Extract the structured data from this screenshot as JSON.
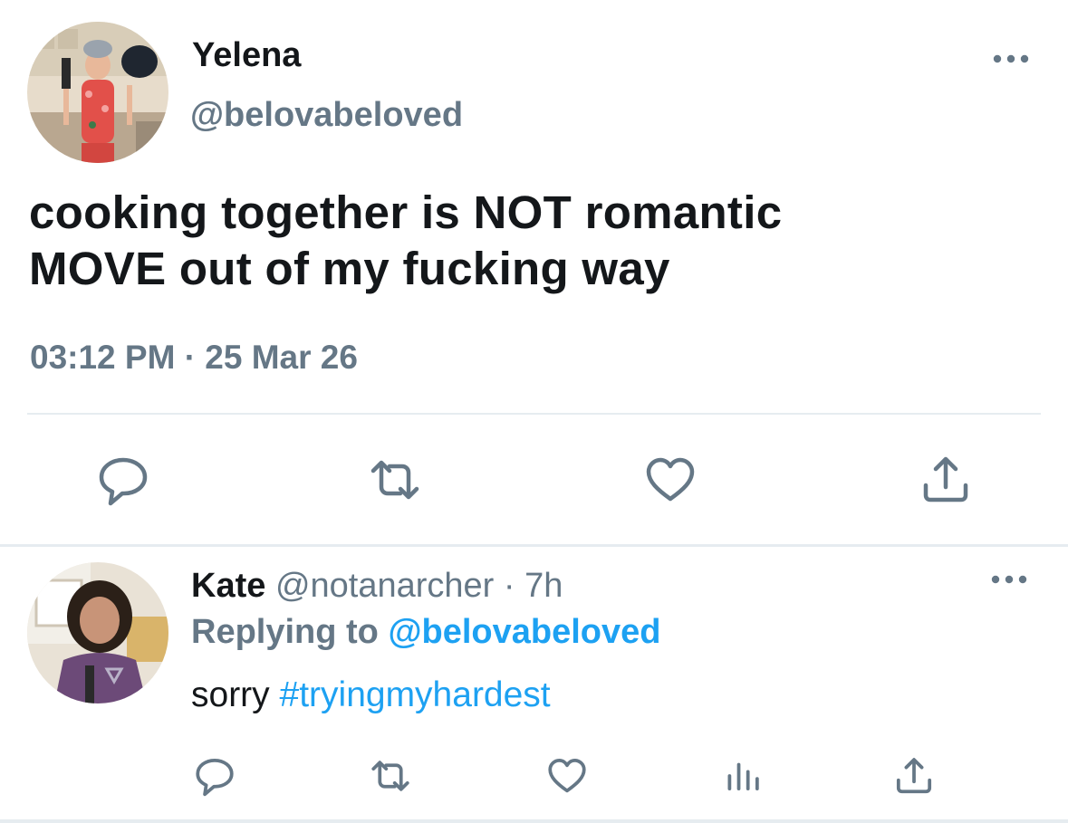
{
  "tweet": {
    "author_name": "Yelena",
    "author_handle": "@belovabeloved",
    "text_line1": "cooking together is NOT romantic",
    "text_line2": "MOVE out of my fucking way",
    "timestamp": "03:12 PM · 25 Mar 26",
    "actions": {
      "reply_icon": "reply-bubble",
      "retweet_icon": "retweet-arrows",
      "like_icon": "heart",
      "share_icon": "share-upload"
    }
  },
  "reply": {
    "author_name": "Kate",
    "author_handle": "@notanarcher",
    "separator": "·",
    "age": "7h",
    "replying_label": "Replying to",
    "replying_mention": "@belovabeloved",
    "body_text": "sorry",
    "body_hashtag": "#tryingmyhardest",
    "actions": {
      "reply_icon": "reply-bubble",
      "retweet_icon": "retweet-arrows",
      "like_icon": "heart",
      "analytics_icon": "bar-chart",
      "share_icon": "share-upload"
    }
  },
  "colors": {
    "text_primary": "#14171a",
    "text_secondary": "#657786",
    "link_blue": "#1da1f2",
    "icon_gray": "#657786",
    "divider": "#e6ecf0"
  }
}
